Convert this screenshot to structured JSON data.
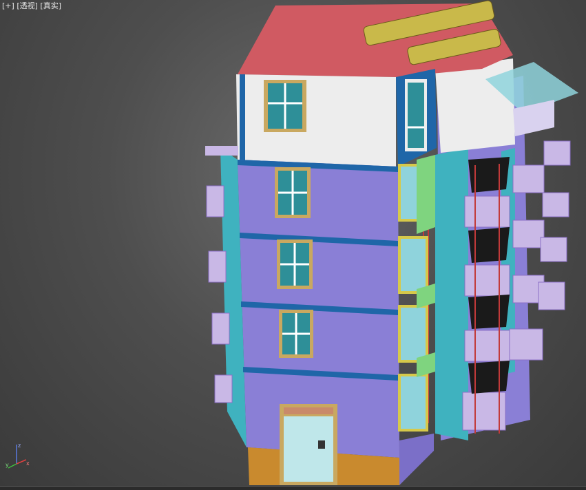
{
  "viewport": {
    "menu_plus": "[+]",
    "view_mode": "[透视]",
    "shading_mode": "[真实]"
  },
  "axis": {
    "x_label": "x",
    "y_label": "y",
    "z_label": "z"
  },
  "colors": {
    "roof": "#d05a62",
    "wall_purple": "#8a7fd6",
    "wall_white": "#ededed",
    "trim_blue": "#1f66a8",
    "teal": "#3fb2bf",
    "balcony": "#c9b8e6",
    "railing": "#c23a3a",
    "base": "#c98a2e",
    "sign_gold": "#c9b94a",
    "glass": "#8fd3dc",
    "axis_x": "#e04040",
    "axis_y": "#40c040",
    "axis_z": "#5a7ae0"
  }
}
